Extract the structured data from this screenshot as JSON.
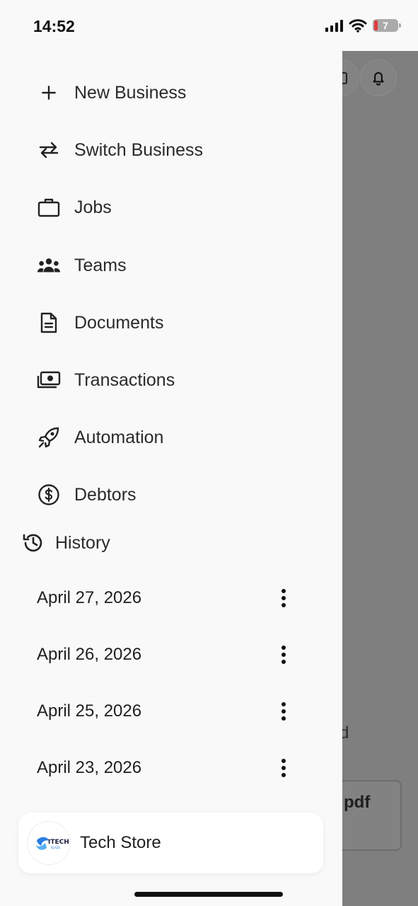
{
  "status_bar": {
    "time": "14:52",
    "battery": "7"
  },
  "menu": {
    "items": [
      {
        "label": "New Business",
        "icon": "plus-icon"
      },
      {
        "label": "Switch Business",
        "icon": "swap-arrows-icon"
      },
      {
        "label": "Jobs",
        "icon": "briefcase-icon"
      },
      {
        "label": "Teams",
        "icon": "team-icon"
      },
      {
        "label": "Documents",
        "icon": "document-icon"
      },
      {
        "label": "Transactions",
        "icon": "money-icon"
      },
      {
        "label": "Automation",
        "icon": "rocket-icon"
      },
      {
        "label": "Debtors",
        "icon": "dollar-circle-icon"
      }
    ]
  },
  "history": {
    "title": "History",
    "items": [
      "April 27, 2026",
      "April 26, 2026",
      "April 25, 2026",
      "April 23, 2026"
    ]
  },
  "business": {
    "name": "Tech Store",
    "logo_text": "ITECH",
    "logo_subtext": "BLAZE"
  },
  "background": {
    "fragment_text": "d",
    "card_text": "pdf"
  }
}
